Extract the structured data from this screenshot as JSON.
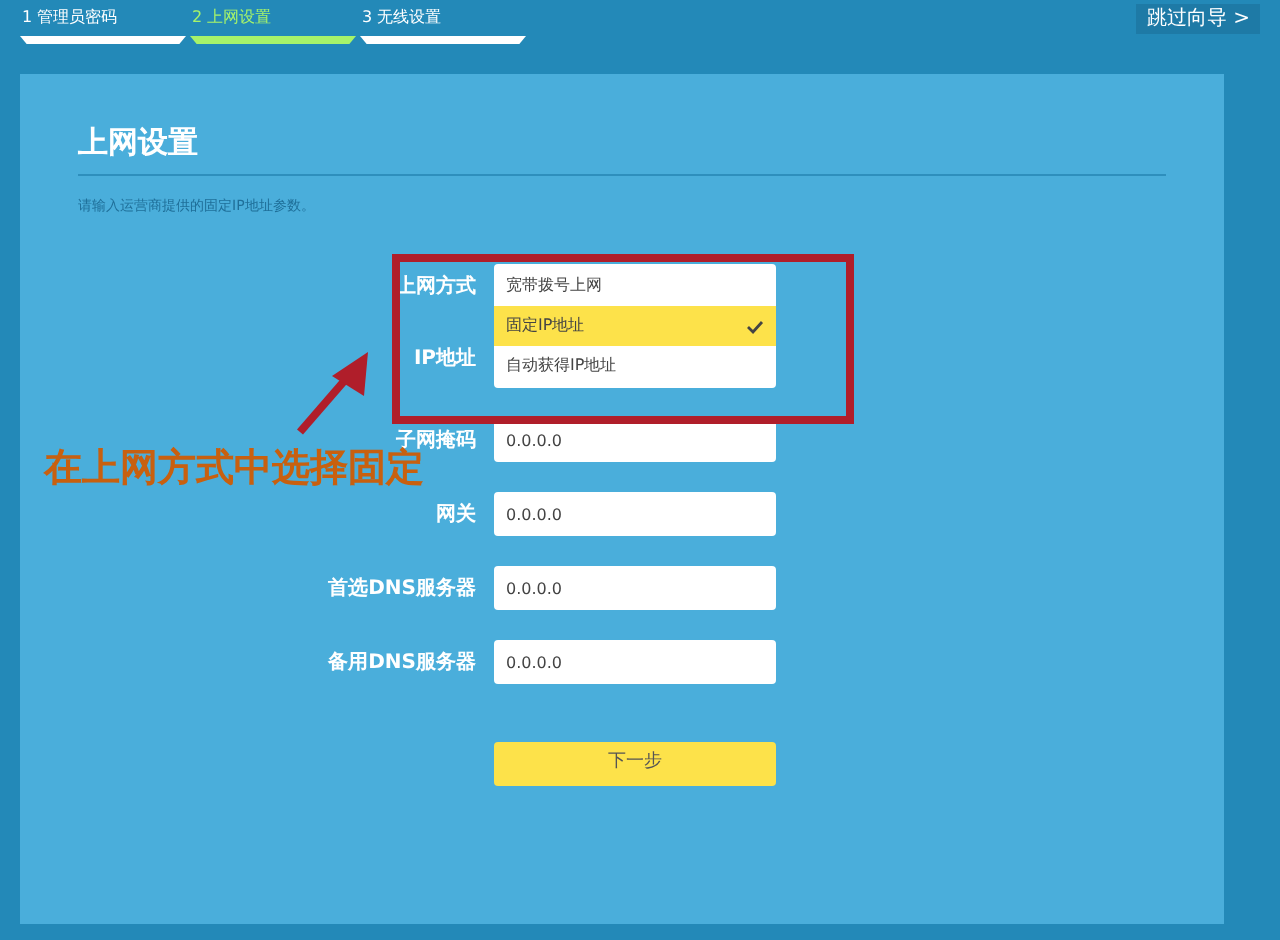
{
  "steps": [
    {
      "label": "1 管理员密码",
      "selected": false
    },
    {
      "label": "2 上网设置",
      "selected": true
    },
    {
      "label": "3 无线设置",
      "selected": false
    }
  ],
  "skip_button": "跳过向导 >",
  "card": {
    "title": "上网设置",
    "description": "请输入运营商提供的固定IP地址参数。"
  },
  "connection_type": {
    "label": "上网方式",
    "options": [
      {
        "label": "宽带拨号上网",
        "selected": false
      },
      {
        "label": "固定IP地址",
        "selected": true
      },
      {
        "label": "自动获得IP地址",
        "selected": false
      }
    ]
  },
  "ip_label": "IP地址",
  "fields": [
    {
      "label": "子网掩码",
      "value": "0.0.0.0"
    },
    {
      "label": "网关",
      "value": "0.0.0.0"
    },
    {
      "label": "首选DNS服务器",
      "value": "0.0.0.0"
    },
    {
      "label": "备用DNS服务器",
      "value": "0.0.0.0"
    }
  ],
  "next_button": "下一步",
  "annotation": {
    "text": "在上网方式中选择固定"
  }
}
